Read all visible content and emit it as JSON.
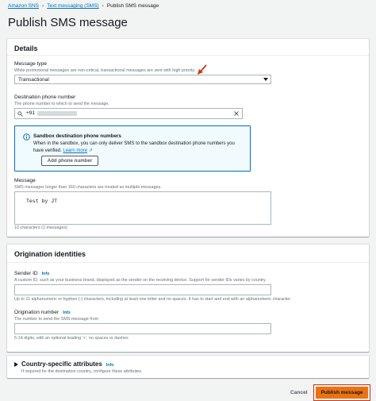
{
  "breadcrumb": {
    "items": [
      "Amazon SNS",
      "Text messaging (SMS)",
      "Publish SMS message"
    ]
  },
  "page": {
    "title": "Publish SMS message"
  },
  "details": {
    "heading": "Details",
    "message_type": {
      "label": "Message type",
      "description": "While promotional messages are non-critical, transactional messages are sent with high priority.",
      "selected": "Transactional"
    },
    "phone": {
      "label": "Destination phone number",
      "description": "The phone number to which to send the message.",
      "value": "+91"
    },
    "sandbox_alert": {
      "title": "Sandbox destination phone numbers",
      "body": "When in the sandbox, you can only deliver SMS to the sandbox destination phone numbers you have verified.",
      "learn_more": "Learn more",
      "button": "Add phone number"
    },
    "message": {
      "label": "Message",
      "description": "SMS messages longer than 160 characters are treated as multiple messages.",
      "value": "Test by JT",
      "counter": "10 characters (1 messages)"
    }
  },
  "origination": {
    "heading": "Origination identities",
    "sender_id": {
      "label": "Sender ID",
      "info": "Info",
      "description": "A custom ID, such as your business brand, displayed as the sender on the receiving device. Support for sender IDs varies by country.",
      "constraint": "Up to 11 alphanumeric or hyphen (-) characters, including at least one letter and no spaces. It has to start and end with an alphanumeric character."
    },
    "origination_number": {
      "label": "Origination number",
      "info": "Info",
      "description": "The number to send the SMS message from",
      "constraint": "5-14 digits, with an optional leading '+', no spaces or dashes"
    }
  },
  "country": {
    "heading": "Country-specific attributes",
    "info": "Info",
    "description": "If required for the destination country, configure these attributes."
  },
  "footer": {
    "cancel": "Cancel",
    "publish": "Publish message"
  },
  "colors": {
    "accent": "#ec7211",
    "link": "#0073bb",
    "alert_bg": "#f1faff",
    "highlight_arrow": "#d13212"
  }
}
